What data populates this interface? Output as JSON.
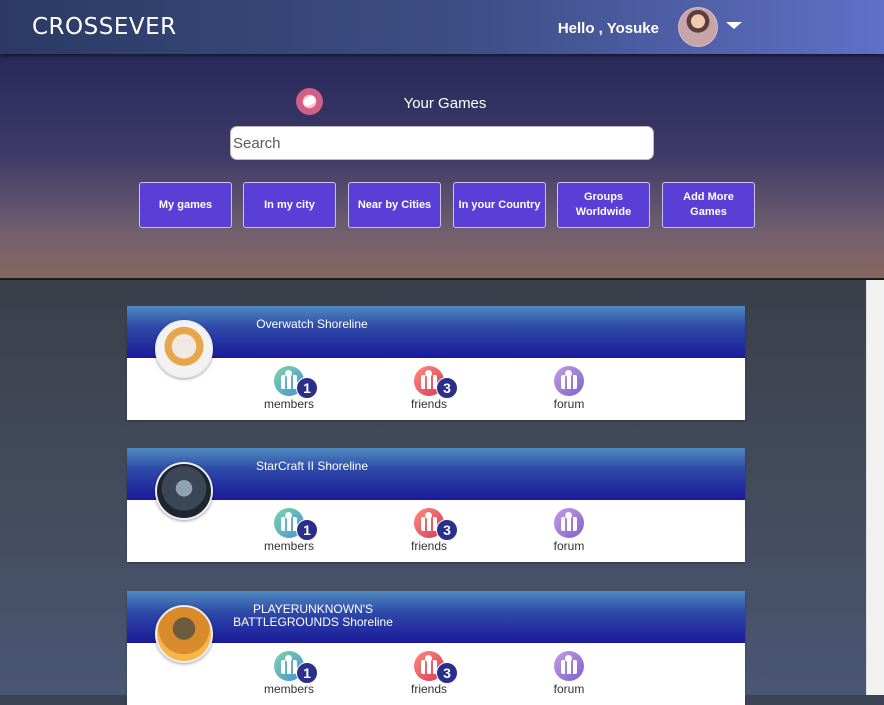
{
  "app": {
    "title": "CROSSEVER"
  },
  "user": {
    "greeting": "Hello , Yosuke"
  },
  "hero": {
    "title": "Your Games",
    "search_placeholder": "Search",
    "filters": [
      "My games",
      "In my city",
      "Near by Cities",
      "In your Country",
      "Groups Worldwide",
      "Add More Games"
    ]
  },
  "games": [
    {
      "name": "Overwatch Shoreline",
      "members": "1",
      "friends": "3",
      "members_label": "members",
      "friends_label": "friends",
      "forum_label": "forum"
    },
    {
      "name": "StarCraft II Shoreline",
      "members": "1",
      "friends": "3",
      "members_label": "members",
      "friends_label": "friends",
      "forum_label": "forum"
    },
    {
      "name": "PLAYERUNKNOWN'S BATTLEGROUNDS Shoreline",
      "members": "1",
      "friends": "3",
      "members_label": "members",
      "friends_label": "friends",
      "forum_label": "forum"
    }
  ],
  "colors": {
    "accent": "#5a3fd6",
    "card_header": "#1b1a9a"
  }
}
